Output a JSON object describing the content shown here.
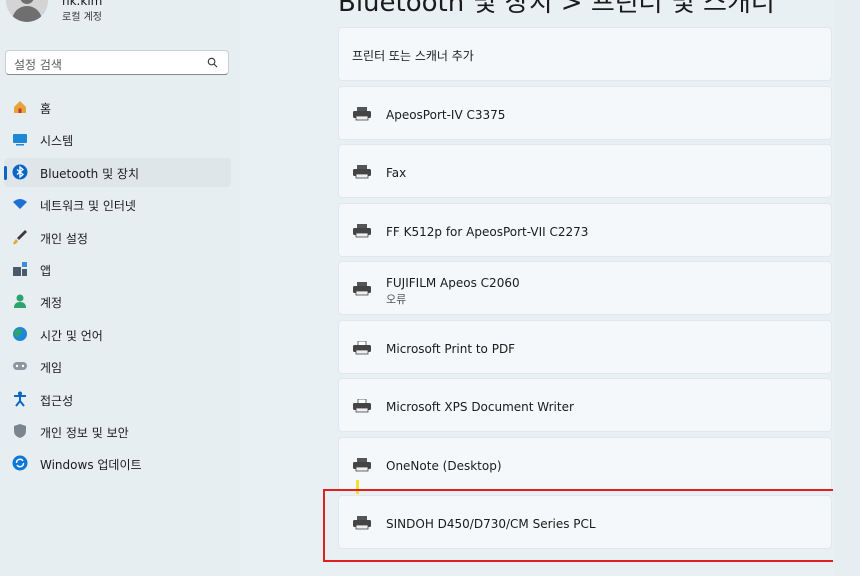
{
  "user": {
    "name": "hk.kim",
    "type": "로컬 계정"
  },
  "search": {
    "placeholder": "설정 검색"
  },
  "nav": [
    {
      "label": "홈",
      "icon": "home-icon"
    },
    {
      "label": "시스템",
      "icon": "system-icon"
    },
    {
      "label": "Bluetooth 및 장치",
      "icon": "bluetooth-icon",
      "active": true
    },
    {
      "label": "네트워크 및 인터넷",
      "icon": "wifi-icon"
    },
    {
      "label": "개인 설정",
      "icon": "brush-icon"
    },
    {
      "label": "앱",
      "icon": "apps-icon"
    },
    {
      "label": "계정",
      "icon": "account-icon"
    },
    {
      "label": "시간 및 언어",
      "icon": "globe-icon"
    },
    {
      "label": "게임",
      "icon": "gamepad-icon"
    },
    {
      "label": "접근성",
      "icon": "accessibility-icon"
    },
    {
      "label": "개인 정보 및 보안",
      "icon": "shield-icon"
    },
    {
      "label": "Windows 업데이트",
      "icon": "update-icon"
    }
  ],
  "page": {
    "title": "Bluetooth 및 장치 > 프린터 및 스캐너"
  },
  "add_printer": {
    "label": "프린터 또는 스캐너 추가"
  },
  "printers": [
    {
      "name": "ApeosPort-IV C3375"
    },
    {
      "name": "Fax"
    },
    {
      "name": "FF K512p for ApeosPort-VII C2273"
    },
    {
      "name": "FUJIFILM Apeos C2060",
      "status": "오류"
    },
    {
      "name": "Microsoft Print to PDF"
    },
    {
      "name": "Microsoft XPS Document Writer"
    },
    {
      "name": "OneNote (Desktop)"
    },
    {
      "name": "SINDOH D450/D730/CM Series PCL"
    }
  ],
  "colors": {
    "accent": "#0a66c2",
    "highlight": "#e02020"
  }
}
